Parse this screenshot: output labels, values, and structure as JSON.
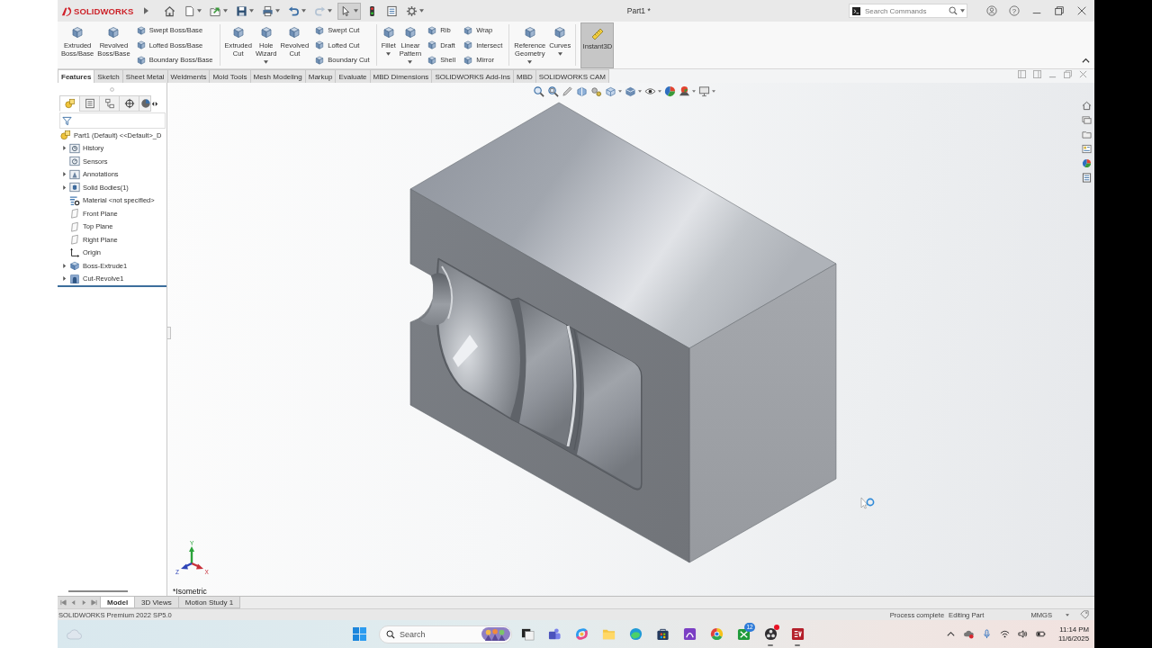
{
  "title_bar": {
    "app_name": "SOLIDWORKS",
    "document_title": "Part1 *",
    "search": {
      "placeholder": "Search Commands"
    },
    "help_glyph": "?"
  },
  "quick_access": [
    {
      "kind": "home",
      "dropdown": false,
      "on": false,
      "disabled": false
    },
    {
      "kind": "new",
      "dropdown": true,
      "on": false,
      "disabled": false
    },
    {
      "kind": "open",
      "dropdown": true,
      "on": false,
      "disabled": false
    },
    {
      "kind": "save",
      "dropdown": true,
      "on": false,
      "disabled": false
    },
    {
      "kind": "print",
      "dropdown": true,
      "on": false,
      "disabled": false
    },
    {
      "kind": "undo",
      "dropdown": true,
      "on": false,
      "disabled": false
    },
    {
      "kind": "redo",
      "dropdown": true,
      "on": false,
      "disabled": true
    },
    {
      "kind": "select",
      "dropdown": true,
      "on": true,
      "disabled": false
    },
    {
      "kind": "rebuild",
      "dropdown": false,
      "on": false,
      "disabled": false
    },
    {
      "kind": "file_properties",
      "dropdown": false,
      "on": false,
      "disabled": false
    },
    {
      "kind": "options",
      "dropdown": true,
      "on": false,
      "disabled": false
    }
  ],
  "ribbon": {
    "groups": [
      {
        "large": [
          {
            "label": "Extruded Boss/Base",
            "dropdown": false
          },
          {
            "label": "Revolved Boss/Base",
            "dropdown": false
          }
        ],
        "columns": [
          [
            "Swept Boss/Base",
            "Lofted Boss/Base",
            "Boundary Boss/Base"
          ]
        ]
      },
      {
        "large": [
          {
            "label": "Extruded Cut",
            "dropdown": false
          },
          {
            "label": "Hole Wizard",
            "dropdown": true
          },
          {
            "label": "Revolved Cut",
            "dropdown": false
          }
        ],
        "columns": [
          [
            "Swept Cut",
            "Lofted Cut",
            "Boundary Cut"
          ]
        ]
      },
      {
        "large": [
          {
            "label": "Fillet",
            "dropdown": true
          },
          {
            "label": "Linear Pattern",
            "dropdown": true
          }
        ],
        "columns": [
          [
            "Rib",
            "Draft",
            "Shell"
          ],
          [
            "Wrap",
            "Intersect",
            "Mirror"
          ]
        ]
      },
      {
        "large": [
          {
            "label": "Reference Geometry",
            "dropdown": true
          },
          {
            "label": "Curves",
            "dropdown": true
          }
        ]
      }
    ],
    "instant3d": {
      "label": "Instant3D",
      "on": true
    }
  },
  "command_tabs": [
    {
      "label": "Features",
      "selected": true
    },
    {
      "label": "Sketch",
      "selected": false
    },
    {
      "label": "Sheet Metal",
      "selected": false
    },
    {
      "label": "Weldments",
      "selected": false
    },
    {
      "label": "Mold Tools",
      "selected": false
    },
    {
      "label": "Mesh Modeling",
      "selected": false
    },
    {
      "label": "Markup",
      "selected": false
    },
    {
      "label": "Evaluate",
      "selected": false
    },
    {
      "label": "MBD Dimensions",
      "selected": false
    },
    {
      "label": "SOLIDWORKS Add-Ins",
      "selected": false
    },
    {
      "label": "MBD",
      "selected": false
    },
    {
      "label": "SOLIDWORKS CAM",
      "selected": false
    }
  ],
  "feature_manager": {
    "tabs": [
      {
        "kind": "features",
        "selected": true
      },
      {
        "kind": "properties",
        "selected": false
      },
      {
        "kind": "configurations",
        "selected": false
      },
      {
        "kind": "dimxpert",
        "selected": false
      },
      {
        "kind": "display",
        "selected": false
      }
    ],
    "tree": {
      "label": "Part1 (Default) <<Default>_D",
      "kind": "part",
      "children": [
        {
          "label": "History",
          "kind": "history",
          "expandable": true,
          "expanded": false
        },
        {
          "label": "Sensors",
          "kind": "sensors",
          "expandable": false
        },
        {
          "label": "Annotations",
          "kind": "annotations",
          "expandable": true,
          "expanded": false
        },
        {
          "label": "Solid Bodies(1)",
          "kind": "bodies",
          "expandable": true,
          "expanded": false
        },
        {
          "label": "Material <not specified>",
          "kind": "material",
          "expandable": false
        },
        {
          "label": "Front Plane",
          "kind": "plane",
          "expandable": false
        },
        {
          "label": "Top Plane",
          "kind": "plane",
          "expandable": false
        },
        {
          "label": "Right Plane",
          "kind": "plane",
          "expandable": false
        },
        {
          "label": "Origin",
          "kind": "origin",
          "expandable": false
        },
        {
          "label": "Boss-Extrude1",
          "kind": "extrude",
          "expandable": true,
          "expanded": false
        },
        {
          "label": "Cut-Revolve1",
          "kind": "revolve",
          "expandable": true,
          "expanded": false
        }
      ]
    }
  },
  "viewport": {
    "view_name": "*Isometric",
    "triad": {
      "x": "X",
      "y": "Y",
      "z": "Z"
    }
  },
  "bottom_tabs": [
    {
      "label": "Model",
      "selected": true
    },
    {
      "label": "3D Views",
      "selected": false
    },
    {
      "label": "Motion Study 1",
      "selected": false
    }
  ],
  "status_bar": {
    "product": "SOLIDWORKS Premium 2022 SP5.0",
    "message": "Process complete",
    "mode": "Editing Part",
    "units": "MMGS"
  },
  "taskbar": {
    "search": {
      "placeholder": "Search"
    },
    "apps": [
      {
        "kind": "task_view",
        "running": false,
        "alert": false
      },
      {
        "kind": "people",
        "running": false,
        "alert": false
      },
      {
        "kind": "swirl",
        "running": false,
        "alert": false
      },
      {
        "kind": "folder",
        "running": false,
        "alert": false
      },
      {
        "kind": "wave",
        "running": false,
        "alert": false
      },
      {
        "kind": "bag",
        "running": false,
        "alert": false
      },
      {
        "kind": "arch_tile",
        "running": false,
        "alert": false
      },
      {
        "kind": "segmented_circle",
        "running": false,
        "alert": false
      },
      {
        "kind": "cross_tile",
        "running": false,
        "alert": false,
        "badge": "12"
      },
      {
        "kind": "dots_circle",
        "running": true,
        "alert": true
      },
      {
        "kind": "logo_tile",
        "running": true,
        "alert": false
      }
    ],
    "clock": {
      "time": "11:14 PM",
      "date": "11/6/2025"
    }
  }
}
